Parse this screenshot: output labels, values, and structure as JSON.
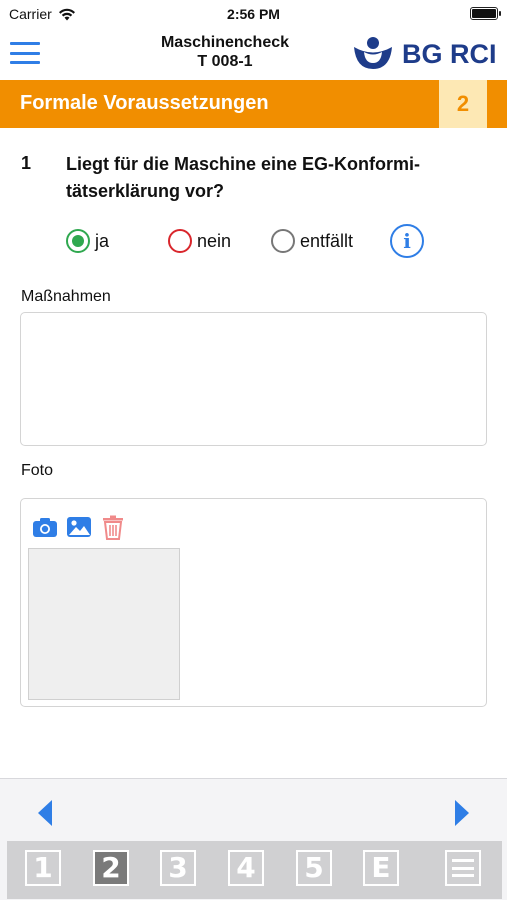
{
  "status_bar": {
    "carrier": "Carrier",
    "time": "2:56 PM"
  },
  "nav": {
    "title_line1": "Maschinencheck",
    "title_line2": "T 008-1",
    "logo_text": "BG RCI"
  },
  "section": {
    "title": "Formale Voraussetzungen",
    "number": "2"
  },
  "question": {
    "number": "1",
    "text": "Liegt für die Maschine eine EG-Konformi­tätserklärung vor?",
    "options": [
      {
        "label": "ja",
        "selected": true,
        "color": "#2fa84f"
      },
      {
        "label": "nein",
        "selected": false,
        "color": "#d9262c"
      },
      {
        "label": "entfällt",
        "selected": false,
        "color": "#777777"
      }
    ],
    "info_glyph": "i"
  },
  "measures": {
    "label": "Maßnahmen",
    "value": ""
  },
  "photo": {
    "label": "Foto",
    "tools": [
      "camera-icon",
      "image-icon",
      "trash-icon"
    ]
  },
  "bottom_nav": {
    "tabs": [
      {
        "label": "1",
        "active": false
      },
      {
        "label": "2",
        "active": true
      },
      {
        "label": "3",
        "active": false
      },
      {
        "label": "4",
        "active": false
      },
      {
        "label": "5",
        "active": false
      },
      {
        "label": "E",
        "active": false
      }
    ]
  },
  "colors": {
    "accent": "#2f7ee6",
    "section_bg": "#f18e00",
    "section_number_bg": "#fde8b4",
    "logo": "#1e3c8a"
  }
}
